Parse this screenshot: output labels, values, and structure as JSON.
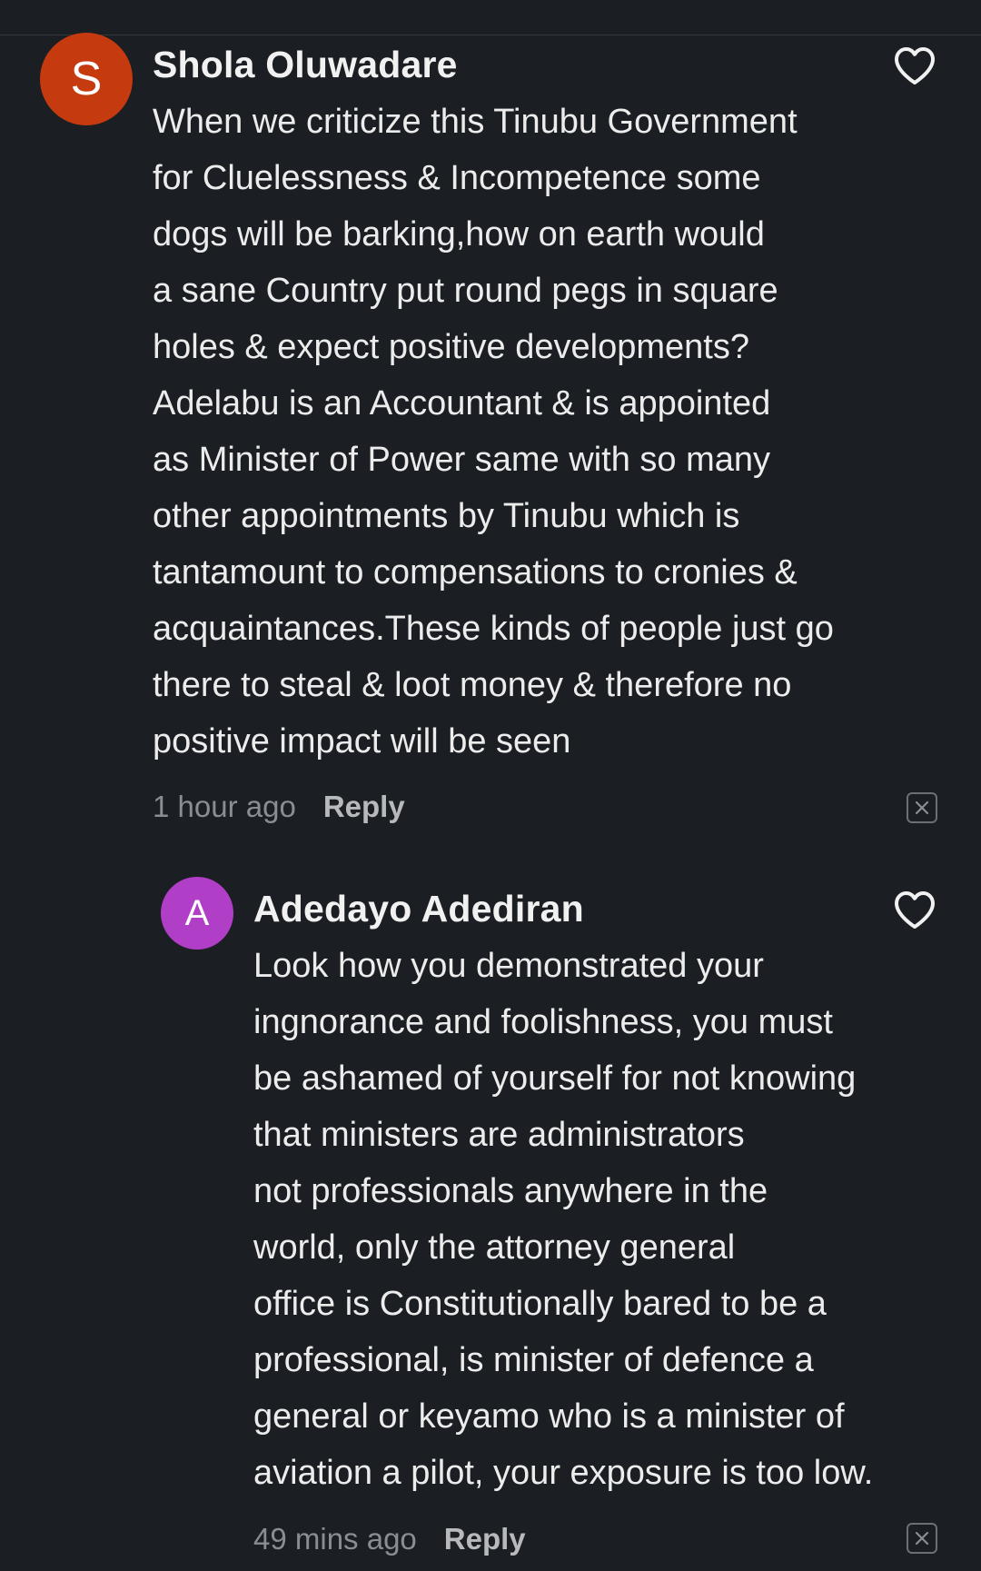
{
  "comments": [
    {
      "avatar_letter": "S",
      "avatar_color": "#c63a10",
      "author": "Shola Oluwadare",
      "text": "When we criticize this Tinubu Government\nfor Cluelessness & Incompetence some\ndogs will be barking,how on earth would\na sane Country put round pegs in square\nholes & expect positive developments?\nAdelabu is an Accountant & is appointed\nas Minister of Power same with so many\nother appointments by Tinubu which is\ntantamount to compensations to cronies &\nacquaintances.These kinds of people just go\nthere to steal & loot money & therefore no\npositive impact will be seen",
      "time": "1 hour ago",
      "reply_label": "Reply",
      "like_icon": "heart-outline-icon",
      "dismiss_icon": "close-box-icon"
    },
    {
      "avatar_letter": "A",
      "avatar_color": "#b13ec6",
      "author": "Adedayo Adediran",
      "text": "Look how you demonstrated your\ningnorance and foolishness, you must\nbe ashamed of yourself for not knowing\nthat ministers are administrators\nnot professionals anywhere in the\nworld, only the attorney general\noffice is Constitutionally bared to be a\nprofessional, is minister of defence a\ngeneral or keyamo who is a minister of\naviation a pilot, your exposure is too low.",
      "time": "49 mins ago",
      "reply_label": "Reply",
      "like_icon": "heart-outline-icon",
      "dismiss_icon": "close-box-icon"
    }
  ]
}
